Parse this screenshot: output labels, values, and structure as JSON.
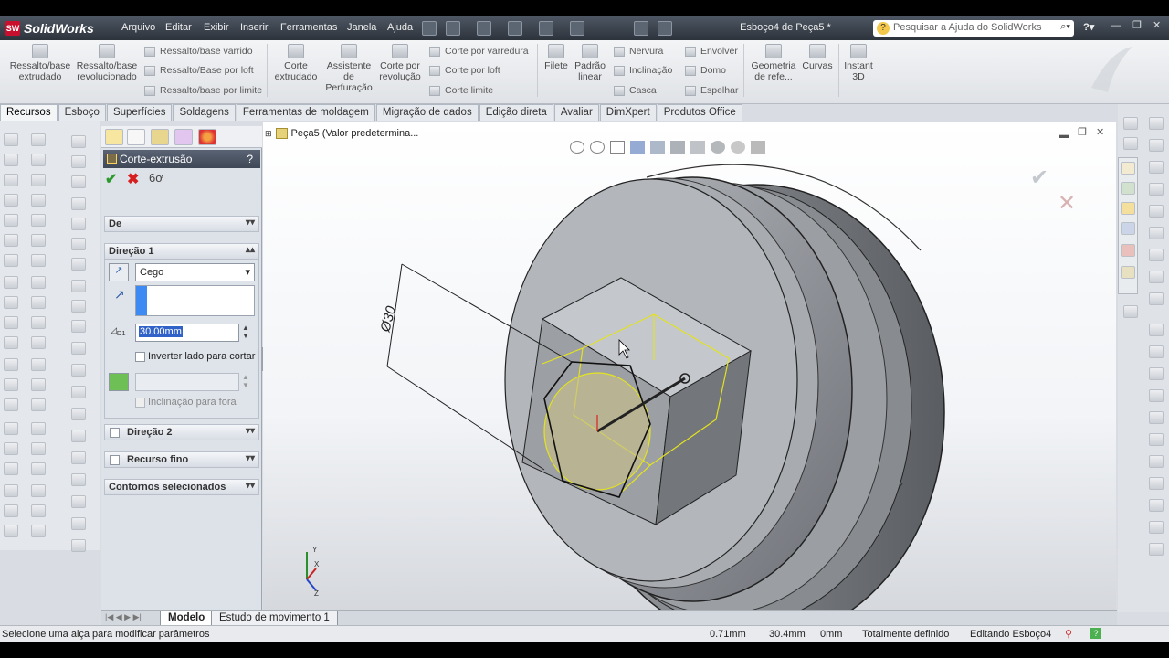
{
  "app": {
    "logo": "SolidWorks",
    "ds": "SW",
    "doc_title": "Esboço4 de Peça5 *"
  },
  "menu": [
    "Arquivo",
    "Editar",
    "Exibir",
    "Inserir",
    "Ferramentas",
    "Janela",
    "Ajuda"
  ],
  "help": {
    "placeholder": "Pesquisar a Ajuda do SolidWorks",
    "q": "?"
  },
  "ribbon": {
    "ressalto_extrudado": "Ressalto/base extrudado",
    "ressalto_revolucionado": "Ressalto/base revolucionado",
    "ressalto_varrido": "Ressalto/base varrido",
    "ressalto_loft": "Ressalto/Base por loft",
    "ressalto_limite": "Ressalto/base por limite",
    "corte_extrudado": "Corte extrudado",
    "assistente": "Assistente de Perfuração",
    "corte_revolucao": "Corte por revolução",
    "corte_varredura": "Corte por varredura",
    "corte_loft": "Corte por loft",
    "corte_limite": "Corte limite",
    "filete": "Filete",
    "padrao_linear": "Padrão linear",
    "nervura": "Nervura",
    "inclinacao": "Inclinação",
    "casca": "Casca",
    "envolver": "Envolver",
    "domo": "Domo",
    "espelhar": "Espelhar",
    "geometria": "Geometria de refe...",
    "curvas": "Curvas",
    "instant3d": "Instant 3D"
  },
  "tabs": [
    "Recursos",
    "Esboço",
    "Superfícies",
    "Soldagens",
    "Ferramentas de moldagem",
    "Migração de dados",
    "Edição direta",
    "Avaliar",
    "DimXpert",
    "Produtos Office"
  ],
  "pm": {
    "title": "Corte-extrusão",
    "help": "?",
    "de": "De",
    "direcao1": "Direção 1",
    "end_condition": "Cego",
    "depth": "30.00mm",
    "inverter": "Inverter lado para cortar",
    "inclinacao_fora": "Inclinação para fora",
    "direcao2": "Direção 2",
    "recurso_fino": "Recurso fino",
    "contornos": "Contornos selecionados",
    "d1": "D1"
  },
  "tree": {
    "label": "Peça5  (Valor predetermina..."
  },
  "viewport": {
    "dimension": "Ø30"
  },
  "bottom_tabs": [
    "Modelo",
    "Estudo de movimento 1"
  ],
  "status": {
    "message": "Selecione uma alça para modificar parâmetros",
    "x": "0.71mm",
    "y": "30.4mm",
    "z": "0mm",
    "state": "Totalmente definido",
    "editing": "Editando Esboço4"
  },
  "colors": {
    "accent": "#c8102e",
    "sketch": "#e3e31e",
    "part": "#8d9096"
  }
}
